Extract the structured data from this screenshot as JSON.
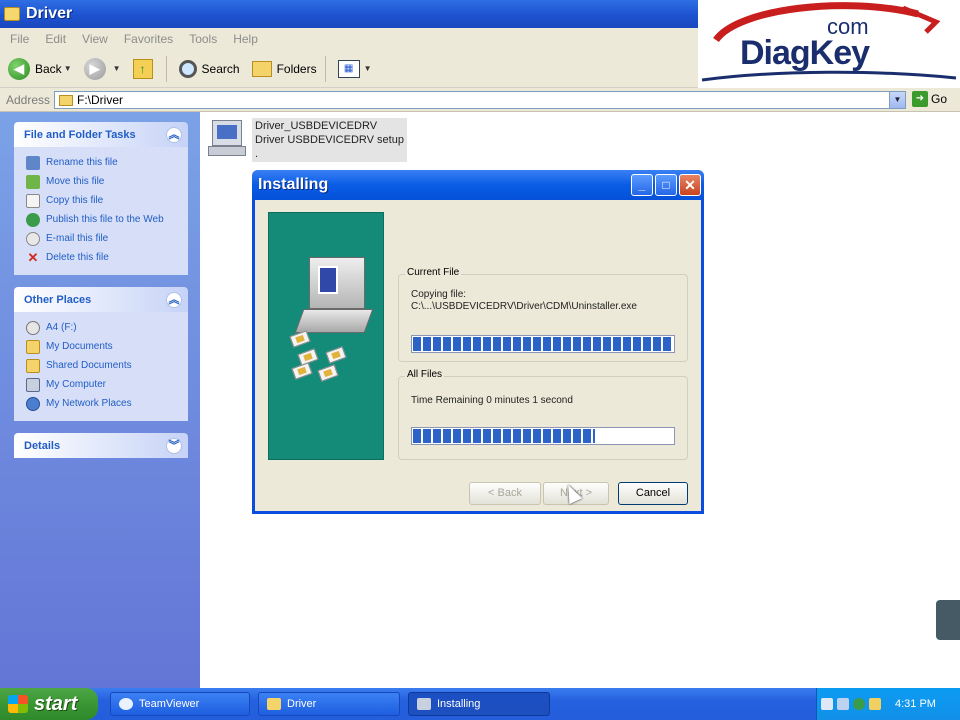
{
  "window": {
    "title": "Driver"
  },
  "logo": {
    "com": "com",
    "name": "DiagKey"
  },
  "menu": {
    "items": [
      "File",
      "Edit",
      "View",
      "Favorites",
      "Tools",
      "Help"
    ]
  },
  "toolbar": {
    "back": "Back",
    "search": "Search",
    "folders": "Folders"
  },
  "address": {
    "label": "Address",
    "value": "F:\\Driver",
    "go": "Go"
  },
  "taskpane": {
    "file_tasks": {
      "title": "File and Folder Tasks",
      "items": [
        "Rename this file",
        "Move this file",
        "Copy this file",
        "Publish this file to the Web",
        "E-mail this file",
        "Delete this file"
      ]
    },
    "other_places": {
      "title": "Other Places",
      "items": [
        "A4 (F:)",
        "My Documents",
        "Shared Documents",
        "My Computer",
        "My Network Places"
      ]
    },
    "details": {
      "title": "Details"
    }
  },
  "file": {
    "name": "Driver_USBDEVICEDRV",
    "desc": "Driver USBDEVICEDRV setup",
    "extra": "."
  },
  "dialog": {
    "title": "Installing",
    "current_file": {
      "legend": "Current File",
      "action": "Copying file:",
      "path": "C:\\...\\USBDEVICEDRV\\Driver\\CDM\\Uninstaller.exe",
      "progress": 1.0
    },
    "all_files": {
      "legend": "All Files",
      "remaining": "Time Remaining 0 minutes 1 second",
      "progress": 0.7
    },
    "buttons": {
      "back": "< Back",
      "next": "Next >",
      "cancel": "Cancel"
    }
  },
  "taskbar": {
    "start": "start",
    "items": [
      "TeamViewer",
      "Driver",
      "Installing"
    ],
    "clock": "4:31 PM"
  }
}
